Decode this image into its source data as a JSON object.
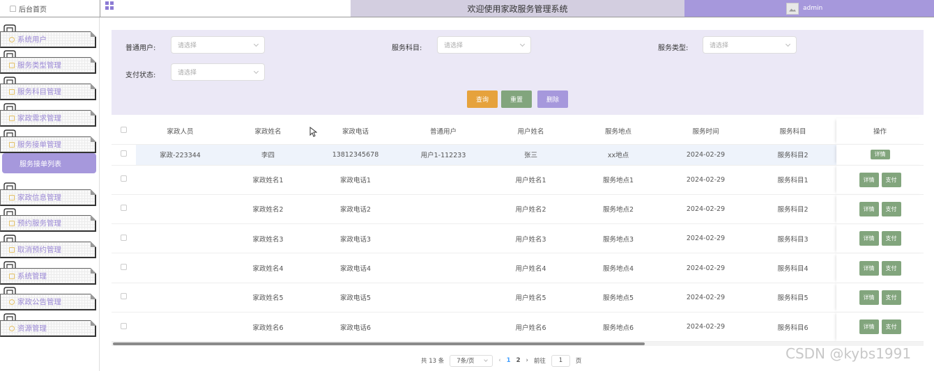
{
  "topbar": {
    "home_label": "后台首页",
    "title": "欢迎使用家政服务管理系统",
    "username": "admin"
  },
  "sidebar": {
    "items": [
      {
        "label": "系统用户",
        "icon": "user-icon"
      },
      {
        "label": "服务类型管理",
        "icon": "doc-icon"
      },
      {
        "label": "服务科目管理",
        "icon": "doc-icon"
      },
      {
        "label": "家政需求管理",
        "icon": "doc-icon"
      },
      {
        "label": "服务接单管理",
        "icon": "doc-icon"
      },
      {
        "label": "家政信息管理",
        "icon": "doc-icon"
      },
      {
        "label": "预约服务管理",
        "icon": "doc-icon"
      },
      {
        "label": "取消预约管理",
        "icon": "doc-icon"
      },
      {
        "label": "系统管理",
        "icon": "doc-icon"
      },
      {
        "label": "家政公告管理",
        "icon": "info-icon"
      },
      {
        "label": "资源管理",
        "icon": "gear-icon"
      }
    ],
    "active_sub": "服务接单列表"
  },
  "filters": {
    "user_label": "普通用户:",
    "subject_label": "服务科目:",
    "type_label": "服务类型:",
    "pay_label": "支付状态:",
    "placeholder": "请选择",
    "query_button": "查询",
    "reset_button": "重置",
    "delete_button": "删除"
  },
  "table": {
    "columns": [
      "家政人员",
      "家政姓名",
      "家政电话",
      "普通用户",
      "用户姓名",
      "服务地点",
      "服务时间",
      "服务科目",
      "操作"
    ],
    "detail_label": "详情",
    "pay_label": "支付",
    "rows": [
      {
        "staff": "家政-223344",
        "name": "李四",
        "phone": "13812345678",
        "user": "用户1-112233",
        "user_name": "张三",
        "location": "xx地点",
        "time": "2024-02-29",
        "subject": "服务科目2",
        "pay": false
      },
      {
        "staff": "",
        "name": "家政姓名1",
        "phone": "家政电话1",
        "user": "",
        "user_name": "用户姓名1",
        "location": "服务地点1",
        "time": "2024-02-29",
        "subject": "服务科目1",
        "pay": true
      },
      {
        "staff": "",
        "name": "家政姓名2",
        "phone": "家政电话2",
        "user": "",
        "user_name": "用户姓名2",
        "location": "服务地点2",
        "time": "2024-02-29",
        "subject": "服务科目2",
        "pay": true
      },
      {
        "staff": "",
        "name": "家政姓名3",
        "phone": "家政电话3",
        "user": "",
        "user_name": "用户姓名3",
        "location": "服务地点3",
        "time": "2024-02-29",
        "subject": "服务科目3",
        "pay": true
      },
      {
        "staff": "",
        "name": "家政姓名4",
        "phone": "家政电话4",
        "user": "",
        "user_name": "用户姓名4",
        "location": "服务地点4",
        "time": "2024-02-29",
        "subject": "服务科目4",
        "pay": true
      },
      {
        "staff": "",
        "name": "家政姓名5",
        "phone": "家政电话5",
        "user": "",
        "user_name": "用户姓名5",
        "location": "服务地点5",
        "time": "2024-02-29",
        "subject": "服务科目5",
        "pay": true
      },
      {
        "staff": "",
        "name": "家政姓名6",
        "phone": "家政电话6",
        "user": "",
        "user_name": "用户姓名6",
        "location": "服务地点6",
        "time": "2024-02-29",
        "subject": "服务科目6",
        "pay": true
      }
    ]
  },
  "pagination": {
    "total": "共 13 条",
    "page_size": "7条/页",
    "pages": [
      "1",
      "2"
    ],
    "active_page": "1",
    "goto_label": "前往",
    "goto_value": "1",
    "page_unit": "页"
  },
  "watermark": "CSDN @kybs1991",
  "colors": {
    "accent": "#a698dc",
    "header_bg": "#d3cee0",
    "filter_bg": "#ebe8f6",
    "query": "#e6a23c",
    "reset": "#82a57d",
    "delete": "#a698dc",
    "op_button": "#82a57d"
  }
}
